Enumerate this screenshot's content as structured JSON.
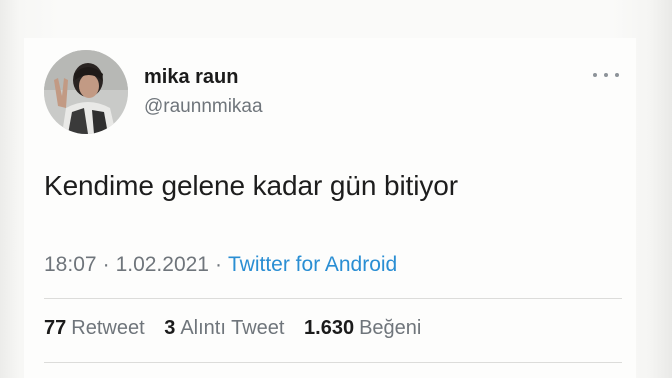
{
  "user": {
    "display_name": "mika raun",
    "handle": "@raunnmikaa"
  },
  "tweet": {
    "text": "Kendime gelene kadar gün bitiyor",
    "time": "18:07",
    "separator": "·",
    "date": "1.02.2021",
    "source": "Twitter for Android"
  },
  "stats": {
    "retweets": {
      "count": "77",
      "label": "Retweet"
    },
    "quotes": {
      "count": "3",
      "label": "Alıntı Tweet"
    },
    "likes": {
      "count": "1.630",
      "label": "Beğeni"
    }
  },
  "icons": {
    "more": "more-horizontal-icon"
  },
  "colors": {
    "link": "#2a8ed3",
    "secondary_text": "#6f757b",
    "primary_text": "#1b1b1b"
  }
}
